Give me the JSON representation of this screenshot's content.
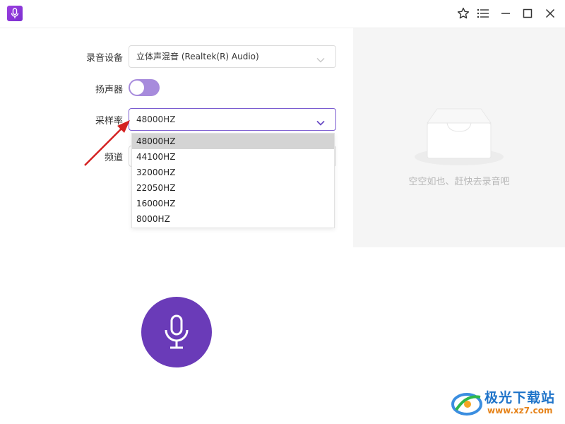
{
  "form": {
    "device_label": "录音设备",
    "device_value": "立体声混音 (Realtek(R) Audio)",
    "speaker_label": "扬声器",
    "speaker_on": false,
    "samplerate_label": "采样率",
    "samplerate_value": "48000HZ",
    "channel_label": "频道"
  },
  "dropdown": {
    "options": [
      "48000HZ",
      "44100HZ",
      "32000HZ",
      "22050HZ",
      "16000HZ",
      "8000HZ"
    ],
    "selected_index": 0
  },
  "panel": {
    "empty_text": "空空如也、赶快去录音吧"
  },
  "icons": {
    "app": "microphone-icon",
    "favorite": "star-icon",
    "menu": "list-icon",
    "minimize": "minimize-icon",
    "maximize": "maximize-icon",
    "close": "close-icon",
    "empty": "inbox-tray-icon",
    "record": "microphone-icon"
  },
  "watermark": {
    "brand": "极光下载站",
    "url": "www.xz7.com"
  },
  "colors": {
    "accent": "#6a3bb8",
    "toggle": "#a78bdc",
    "selection": "#d4d4d4"
  }
}
